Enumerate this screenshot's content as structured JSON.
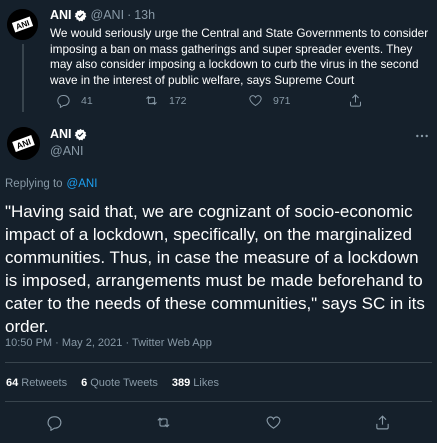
{
  "tweet1": {
    "name": "ANI",
    "handle": "@ANI",
    "separator": "·",
    "time": "13h",
    "text": "We would seriously urge the Central and State Governments to consider imposing a ban on mass gatherings and super spreader events. They may also consider imposing a lockdown to curb the virus in the second wave in the interest of public welfare, says Supreme Court",
    "replies": "41",
    "retweets": "172",
    "likes": "971"
  },
  "tweet2": {
    "name": "ANI",
    "handle": "@ANI",
    "replying_prefix": "Replying to",
    "replying_to": "@ANI",
    "text": "\"Having said that, we are cognizant of socio-economic impact of a lockdown, specifically, on the marginalized communities. Thus, in case the measure of a lockdown is imposed, arrangements must be made beforehand to cater to the needs of these communities,\" says SC in its order.",
    "timestamp": "10:50 PM · May 2, 2021 · Twitter Web App",
    "retweets_count": "64",
    "retweets_label": "Retweets",
    "quotes_count": "6",
    "quotes_label": "Quote Tweets",
    "likes_count": "389",
    "likes_label": "Likes"
  },
  "avatar_text": "ANI",
  "colors": {
    "background": "#15202b",
    "text": "#ffffff",
    "muted": "#8899a6",
    "link": "#1da1f2",
    "divider": "#38444d"
  },
  "icons": [
    "verified-badge-icon",
    "reply-icon",
    "retweet-icon",
    "like-icon",
    "share-icon",
    "more-icon"
  ]
}
